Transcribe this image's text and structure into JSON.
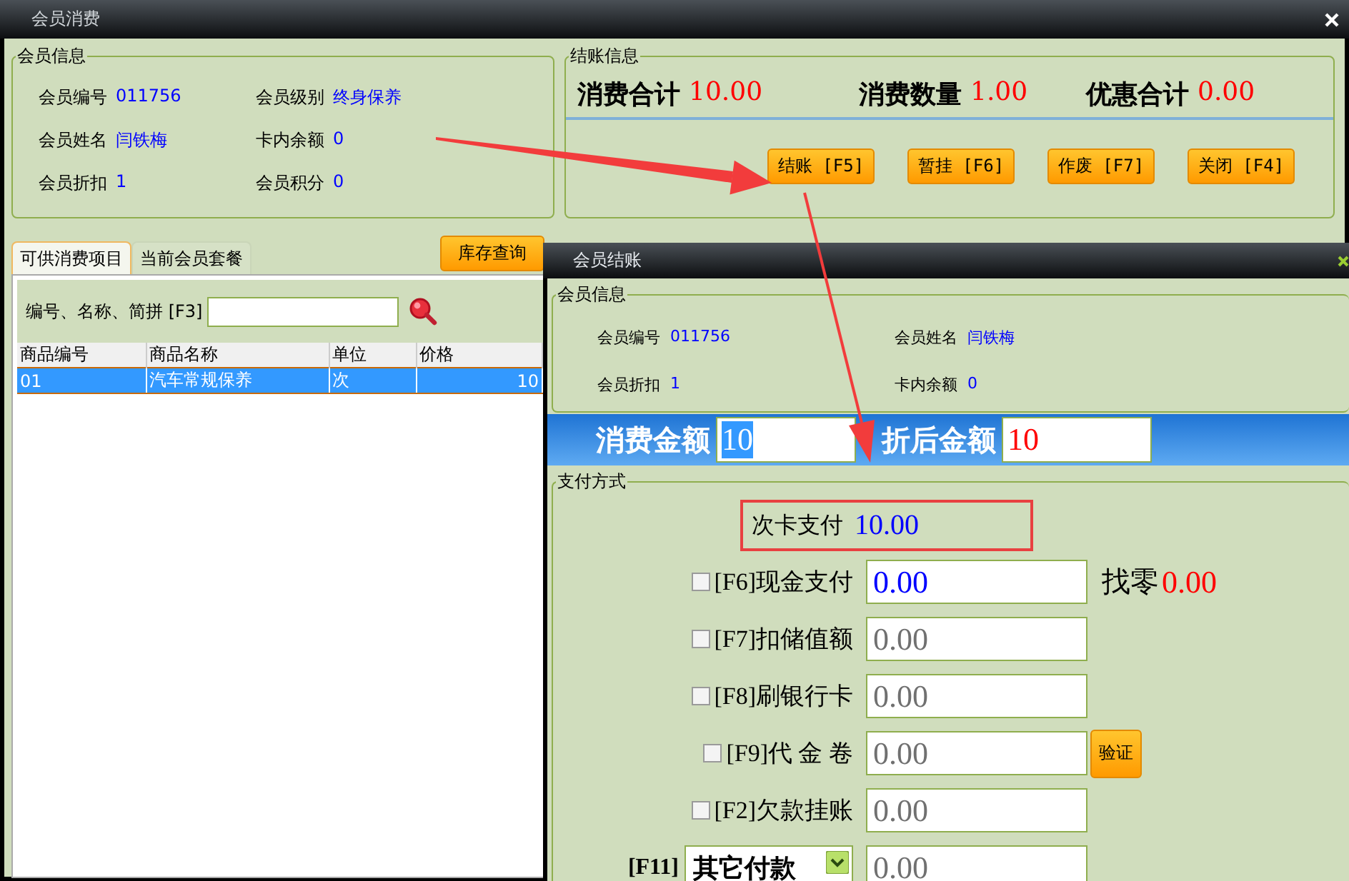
{
  "window": {
    "title": "会员消费"
  },
  "member_info": {
    "title": "会员信息",
    "fields": [
      {
        "label": "会员编号",
        "value": "011756"
      },
      {
        "label": "会员级别",
        "value": "终身保养"
      },
      {
        "label": "会员姓名",
        "value": "闫铁梅"
      },
      {
        "label": "卡内余额",
        "value": "0"
      },
      {
        "label": "会员折扣",
        "value": "1"
      },
      {
        "label": "会员积分",
        "value": "0"
      }
    ]
  },
  "checkout_info": {
    "title": "结账信息",
    "totals": [
      {
        "label": "消费合计",
        "value": "10.00"
      },
      {
        "label": "消费数量",
        "value": "1.00"
      },
      {
        "label": "优惠合计",
        "value": "0.00"
      }
    ],
    "buttons": [
      "结账 [F5]",
      "暂挂 [F6]",
      "作废 [F7]",
      "关闭 [F4]"
    ]
  },
  "tabs": [
    {
      "label": "可供消费项目",
      "selected": true
    },
    {
      "label": "当前会员套餐",
      "selected": false
    }
  ],
  "stock_button": "库存查询",
  "search": {
    "label": "编号、名称、简拼 [F3]"
  },
  "table": {
    "columns": [
      "商品编号",
      "商品名称",
      "单位",
      "价格"
    ],
    "rows": [
      {
        "cells": [
          "01",
          "汽车常规保养",
          "次",
          "10"
        ],
        "selected": true
      }
    ]
  },
  "dialog": {
    "title": "会员结账",
    "member_info": {
      "title": "会员信息",
      "fields": [
        {
          "label": "会员编号",
          "value": "011756"
        },
        {
          "label": "会员姓名",
          "value": "闫铁梅"
        },
        {
          "label": "会员折扣",
          "value": "1"
        },
        {
          "label": "卡内余额",
          "value": "0"
        }
      ]
    },
    "amounts": [
      {
        "label": "消费金额",
        "value": "10",
        "highlighted": true
      },
      {
        "label": "折后金额",
        "value": "10",
        "highlighted": false
      }
    ],
    "payment": {
      "title": "支付方式",
      "card_payment": {
        "label": "次卡支付",
        "value": "10.00"
      },
      "methods": [
        {
          "kind": "checkbox",
          "label": "[F6]现金支付",
          "checked": false,
          "value": "0.00",
          "active": true,
          "change": {
            "label": "找零",
            "value": "0.00"
          }
        },
        {
          "kind": "checkbox",
          "label": "[F7]扣储值额",
          "checked": false,
          "value": "0.00",
          "active": false
        },
        {
          "kind": "checkbox",
          "label": "[F8]刷银行卡",
          "checked": false,
          "value": "0.00",
          "active": false
        },
        {
          "kind": "checkbox",
          "label": "[F9]代 金 卷",
          "checked": false,
          "value": "0.00",
          "active": false,
          "action": "验证"
        },
        {
          "kind": "checkbox",
          "label": "[F2]欠款挂账",
          "checked": false,
          "value": "0.00",
          "active": false
        },
        {
          "kind": "dropdown",
          "key": "[F11]",
          "option": "其它付款",
          "value": "0.00",
          "active": false
        }
      ]
    }
  }
}
